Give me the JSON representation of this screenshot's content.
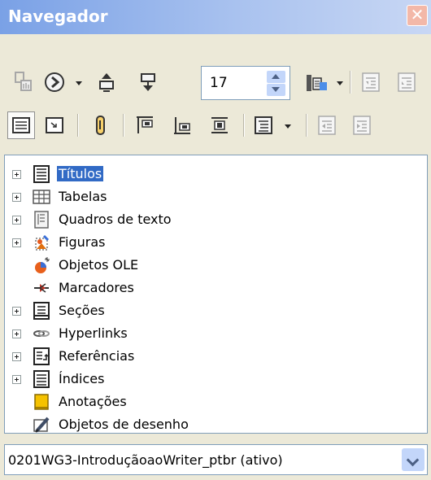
{
  "window": {
    "title": "Navegador"
  },
  "toolbar": {
    "page_number": "17",
    "row1_buttons": [
      "navigation-toggle",
      "navigate-by",
      "previous-object",
      "next-object",
      "page-spin",
      "drag-mode",
      "promote-level",
      "demote-level"
    ],
    "row2_buttons": [
      "list-box-toggle",
      "content-view",
      "set-reminder",
      "header",
      "footer",
      "anchor-text",
      "heading-levels-shown",
      "promote-chapter",
      "demote-chapter"
    ]
  },
  "tree": {
    "items": [
      {
        "label": "Títulos",
        "icon": "headings-icon",
        "expandable": true,
        "selected": true
      },
      {
        "label": "Tabelas",
        "icon": "table-icon",
        "expandable": true,
        "selected": false
      },
      {
        "label": "Quadros de texto",
        "icon": "text-frame-icon",
        "expandable": true,
        "selected": false
      },
      {
        "label": "Figuras",
        "icon": "graphics-icon",
        "expandable": true,
        "selected": false
      },
      {
        "label": "Objetos OLE",
        "icon": "ole-object-icon",
        "expandable": false,
        "selected": false
      },
      {
        "label": "Marcadores",
        "icon": "bookmark-icon",
        "expandable": false,
        "selected": false
      },
      {
        "label": "Seções",
        "icon": "section-icon",
        "expandable": true,
        "selected": false
      },
      {
        "label": "Hyperlinks",
        "icon": "hyperlink-icon",
        "expandable": true,
        "selected": false
      },
      {
        "label": "Referências",
        "icon": "reference-icon",
        "expandable": true,
        "selected": false
      },
      {
        "label": "Índices",
        "icon": "index-icon",
        "expandable": true,
        "selected": false
      },
      {
        "label": "Anotações",
        "icon": "comment-icon",
        "expandable": false,
        "selected": false
      },
      {
        "label": "Objetos de desenho",
        "icon": "drawing-object-icon",
        "expandable": false,
        "selected": false
      }
    ]
  },
  "document_select": {
    "value": "0201WG3-IntroduçãoaoWriter_ptbr (ativo)"
  },
  "colors": {
    "selection": "#316ac5",
    "titlebar": "#7aa1e6",
    "panel": "#ece9d8"
  }
}
